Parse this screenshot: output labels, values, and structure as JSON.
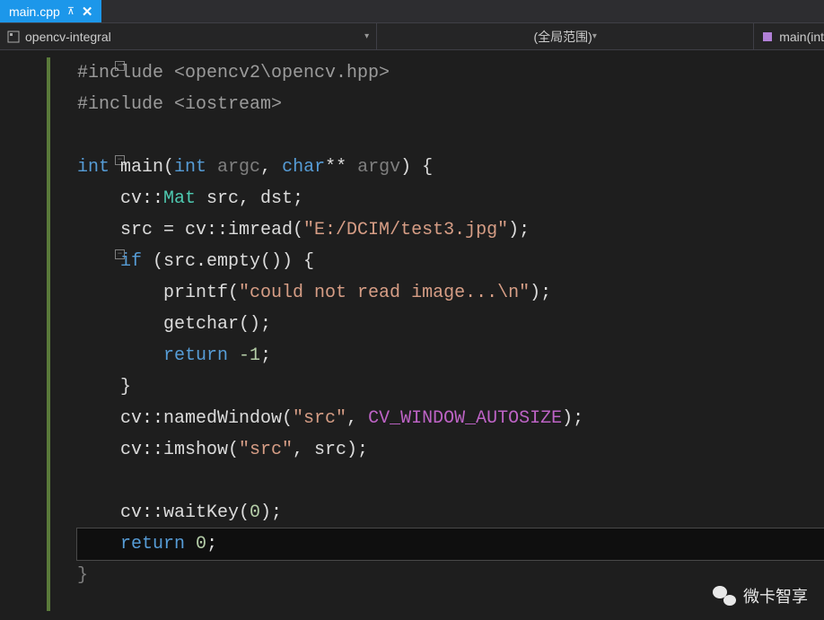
{
  "tab": {
    "filename": "main.cpp",
    "pin_glyph": "📌",
    "close_glyph": "✕"
  },
  "navbar": {
    "project": "opencv-integral",
    "scope": "(全局范围)",
    "symbol_prefix": "main(int"
  },
  "code": {
    "l1": {
      "pp": "#include",
      "rest": " <opencv2\\opencv.hpp>"
    },
    "l2": {
      "pp": "#include",
      "rest": " <iostream>"
    },
    "l4a": "int",
    "l4b": " main(",
    "l4c": "int",
    "l4d": " argc",
    "l4e": ", ",
    "l4f": "char",
    "l4g": "**",
    "l4h": " argv",
    "l4i": ") {",
    "l5a": "    cv::",
    "l5b": "Mat",
    "l5c": " src, dst;",
    "l6a": "    src = cv::imread(",
    "l6b": "\"E:/DCIM/test3.jpg\"",
    "l6c": ");",
    "l7a": "    ",
    "l7b": "if",
    "l7c": " (src.empty()) {",
    "l8a": "        printf(",
    "l8b": "\"could not read image...\\n\"",
    "l8c": ");",
    "l9": "        getchar();",
    "l10a": "        ",
    "l10b": "return",
    "l10c": " ",
    "l10d": "-1",
    "l10e": ";",
    "l11": "    }",
    "l12a": "    cv::namedWindow(",
    "l12b": "\"src\"",
    "l12c": ", ",
    "l12d": "CV_WINDOW_AUTOSIZE",
    "l12e": ");",
    "l13a": "    cv::imshow(",
    "l13b": "\"src\"",
    "l13c": ", src);",
    "l15a": "    cv::waitKey(",
    "l15b": "0",
    "l15c": ");",
    "l16a": "    ",
    "l16b": "return",
    "l16c": " ",
    "l16d": "0",
    "l16e": ";",
    "l17": "}"
  },
  "watermark": "微卡智享"
}
